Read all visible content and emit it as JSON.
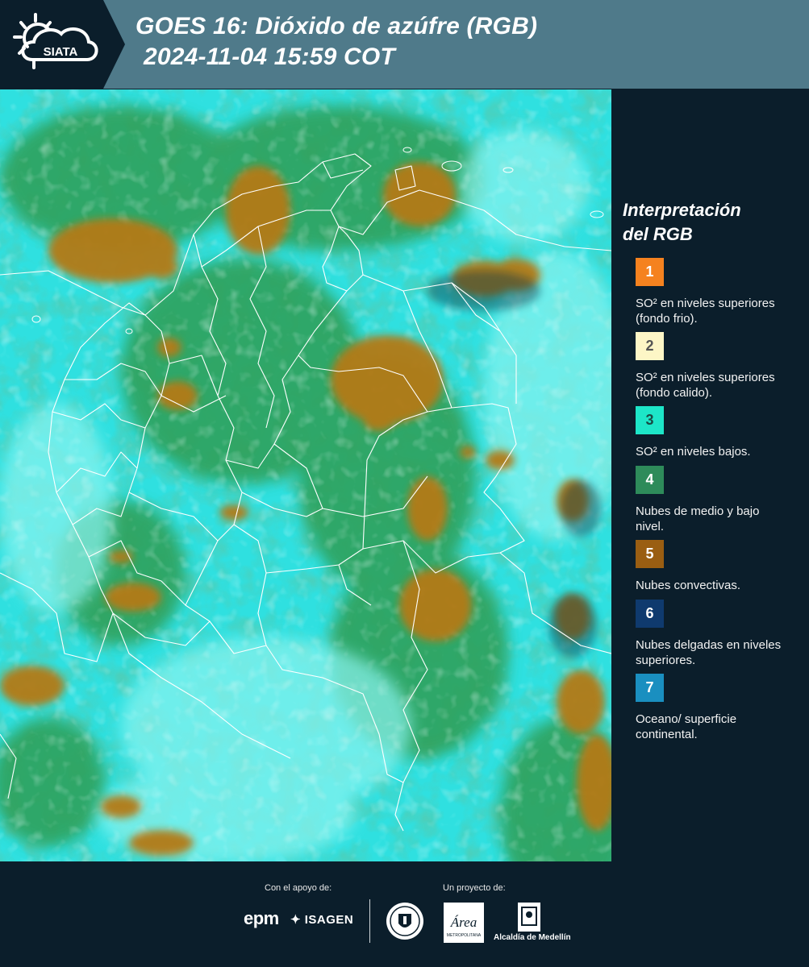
{
  "header": {
    "logo_text": "SIATA",
    "title": "GOES 16: Dióxido de azúfre (RGB)",
    "datetime": "2024-11-04 15:59 COT"
  },
  "legend": {
    "title_line1": "Interpretación",
    "title_line2": "del RGB",
    "items": [
      {
        "number": "1",
        "color": "#f5821f",
        "text_color": "#ffffff",
        "text": "SO² en niveles superiores (fondo frio)."
      },
      {
        "number": "2",
        "color": "#fdf6c6",
        "text_color": "#555555",
        "text": "SO² en niveles superiores (fondo calido)."
      },
      {
        "number": "3",
        "color": "#1de6c8",
        "text_color": "#1a4a44",
        "text": "SO² en niveles bajos."
      },
      {
        "number": "4",
        "color": "#2e8b5a",
        "text_color": "#ffffff",
        "text": "Nubes de medio y bajo nivel."
      },
      {
        "number": "5",
        "color": "#9a5e12",
        "text_color": "#ffffff",
        "text": "Nubes convectivas."
      },
      {
        "number": "6",
        "color": "#0f3a6e",
        "text_color": "#ffffff",
        "text": "Nubes delgadas en niveles superiores."
      },
      {
        "number": "7",
        "color": "#1a8fc0",
        "text_color": "#ffffff",
        "text": "Oceano/ superficie continental."
      }
    ]
  },
  "footer": {
    "support_label": "Con el apoyo de:",
    "project_label": "Un proyecto de:",
    "epm": "epm",
    "isagen": "ISAGEN",
    "area_text": "Área",
    "area_sub": "METROPOLITANA",
    "alcaldia": "Alcaldía de Medellín"
  },
  "map": {
    "icon": "satellite-rgb-image",
    "colors": {
      "ocean_cyan": "#2fe0e0",
      "green_cloud": "#2f9e55",
      "dark_green": "#1f6e45",
      "brown_convective": "#b37a18",
      "dark_thin": "#0f3a4a",
      "border_line": "#ffffff"
    }
  }
}
